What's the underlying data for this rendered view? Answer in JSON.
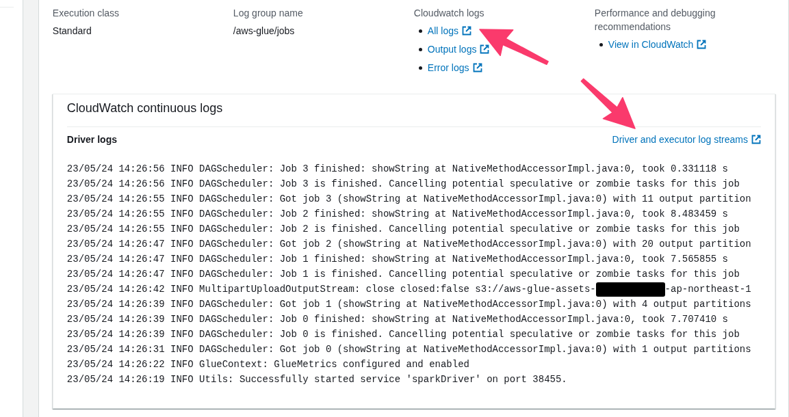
{
  "details": {
    "fields": [
      {
        "label": "Execution class",
        "kind": "value",
        "value": "Standard"
      },
      {
        "label": "Log group name",
        "kind": "value",
        "value": "/aws-glue/jobs"
      },
      {
        "label": "Cloudwatch logs",
        "kind": "links",
        "links": [
          "All logs",
          "Output logs",
          "Error logs"
        ]
      },
      {
        "label": "Performance and debugging recommendations",
        "kind": "links",
        "links": [
          "View in CloudWatch"
        ]
      }
    ]
  },
  "continuous_logs": {
    "title": "CloudWatch continuous logs",
    "subtitle": "Driver logs",
    "streams_link": "Driver and executor log streams",
    "lines": [
      {
        "parts": [
          {
            "kind": "text",
            "text": "23/05/24 14:26:56 INFO DAGScheduler: Job 3 finished: showString at NativeMethodAccessorImpl.java:0, took 0.331118 s"
          }
        ]
      },
      {
        "parts": [
          {
            "kind": "text",
            "text": "23/05/24 14:26:56 INFO DAGScheduler: Job 3 is finished. Cancelling potential speculative or zombie tasks for this job"
          }
        ]
      },
      {
        "parts": [
          {
            "kind": "text",
            "text": "23/05/24 14:26:55 INFO DAGScheduler: Got job 3 (showString at NativeMethodAccessorImpl.java:0) with 11 output partition"
          }
        ]
      },
      {
        "parts": [
          {
            "kind": "text",
            "text": "23/05/24 14:26:55 INFO DAGScheduler: Job 2 finished: showString at NativeMethodAccessorImpl.java:0, took 8.483459 s"
          }
        ]
      },
      {
        "parts": [
          {
            "kind": "text",
            "text": "23/05/24 14:26:55 INFO DAGScheduler: Job 2 is finished. Cancelling potential speculative or zombie tasks for this job"
          }
        ]
      },
      {
        "parts": [
          {
            "kind": "text",
            "text": "23/05/24 14:26:47 INFO DAGScheduler: Got job 2 (showString at NativeMethodAccessorImpl.java:0) with 20 output partition"
          }
        ]
      },
      {
        "parts": [
          {
            "kind": "text",
            "text": "23/05/24 14:26:47 INFO DAGScheduler: Job 1 finished: showString at NativeMethodAccessorImpl.java:0, took 7.565855 s"
          }
        ]
      },
      {
        "parts": [
          {
            "kind": "text",
            "text": "23/05/24 14:26:47 INFO DAGScheduler: Job 1 is finished. Cancelling potential speculative or zombie tasks for this job"
          }
        ]
      },
      {
        "parts": [
          {
            "kind": "text",
            "text": "23/05/24 14:26:42 INFO MultipartUploadOutputStream: close closed:false s3://aws-glue-assets-"
          },
          {
            "kind": "redaction"
          },
          {
            "kind": "text",
            "text": "-ap-northeast-1"
          }
        ]
      },
      {
        "parts": [
          {
            "kind": "text",
            "text": "23/05/24 14:26:39 INFO DAGScheduler: Got job 1 (showString at NativeMethodAccessorImpl.java:0) with 4 output partitions"
          }
        ]
      },
      {
        "parts": [
          {
            "kind": "text",
            "text": "23/05/24 14:26:39 INFO DAGScheduler: Job 0 finished: showString at NativeMethodAccessorImpl.java:0, took 7.707410 s"
          }
        ]
      },
      {
        "parts": [
          {
            "kind": "text",
            "text": "23/05/24 14:26:39 INFO DAGScheduler: Job 0 is finished. Cancelling potential speculative or zombie tasks for this job"
          }
        ]
      },
      {
        "parts": [
          {
            "kind": "text",
            "text": "23/05/24 14:26:31 INFO DAGScheduler: Got job 0 (showString at NativeMethodAccessorImpl.java:0) with 1 output partitions"
          }
        ]
      },
      {
        "parts": [
          {
            "kind": "text",
            "text": "23/05/24 14:26:22 INFO GlueContext: GlueMetrics configured and enabled"
          }
        ]
      },
      {
        "parts": [
          {
            "kind": "text",
            "text": "23/05/24 14:26:19 INFO Utils: Successfully started service 'sparkDriver' on port 38455."
          }
        ]
      }
    ]
  },
  "annotations": [
    {
      "kind": "arrow"
    },
    {
      "kind": "arrow"
    }
  ]
}
